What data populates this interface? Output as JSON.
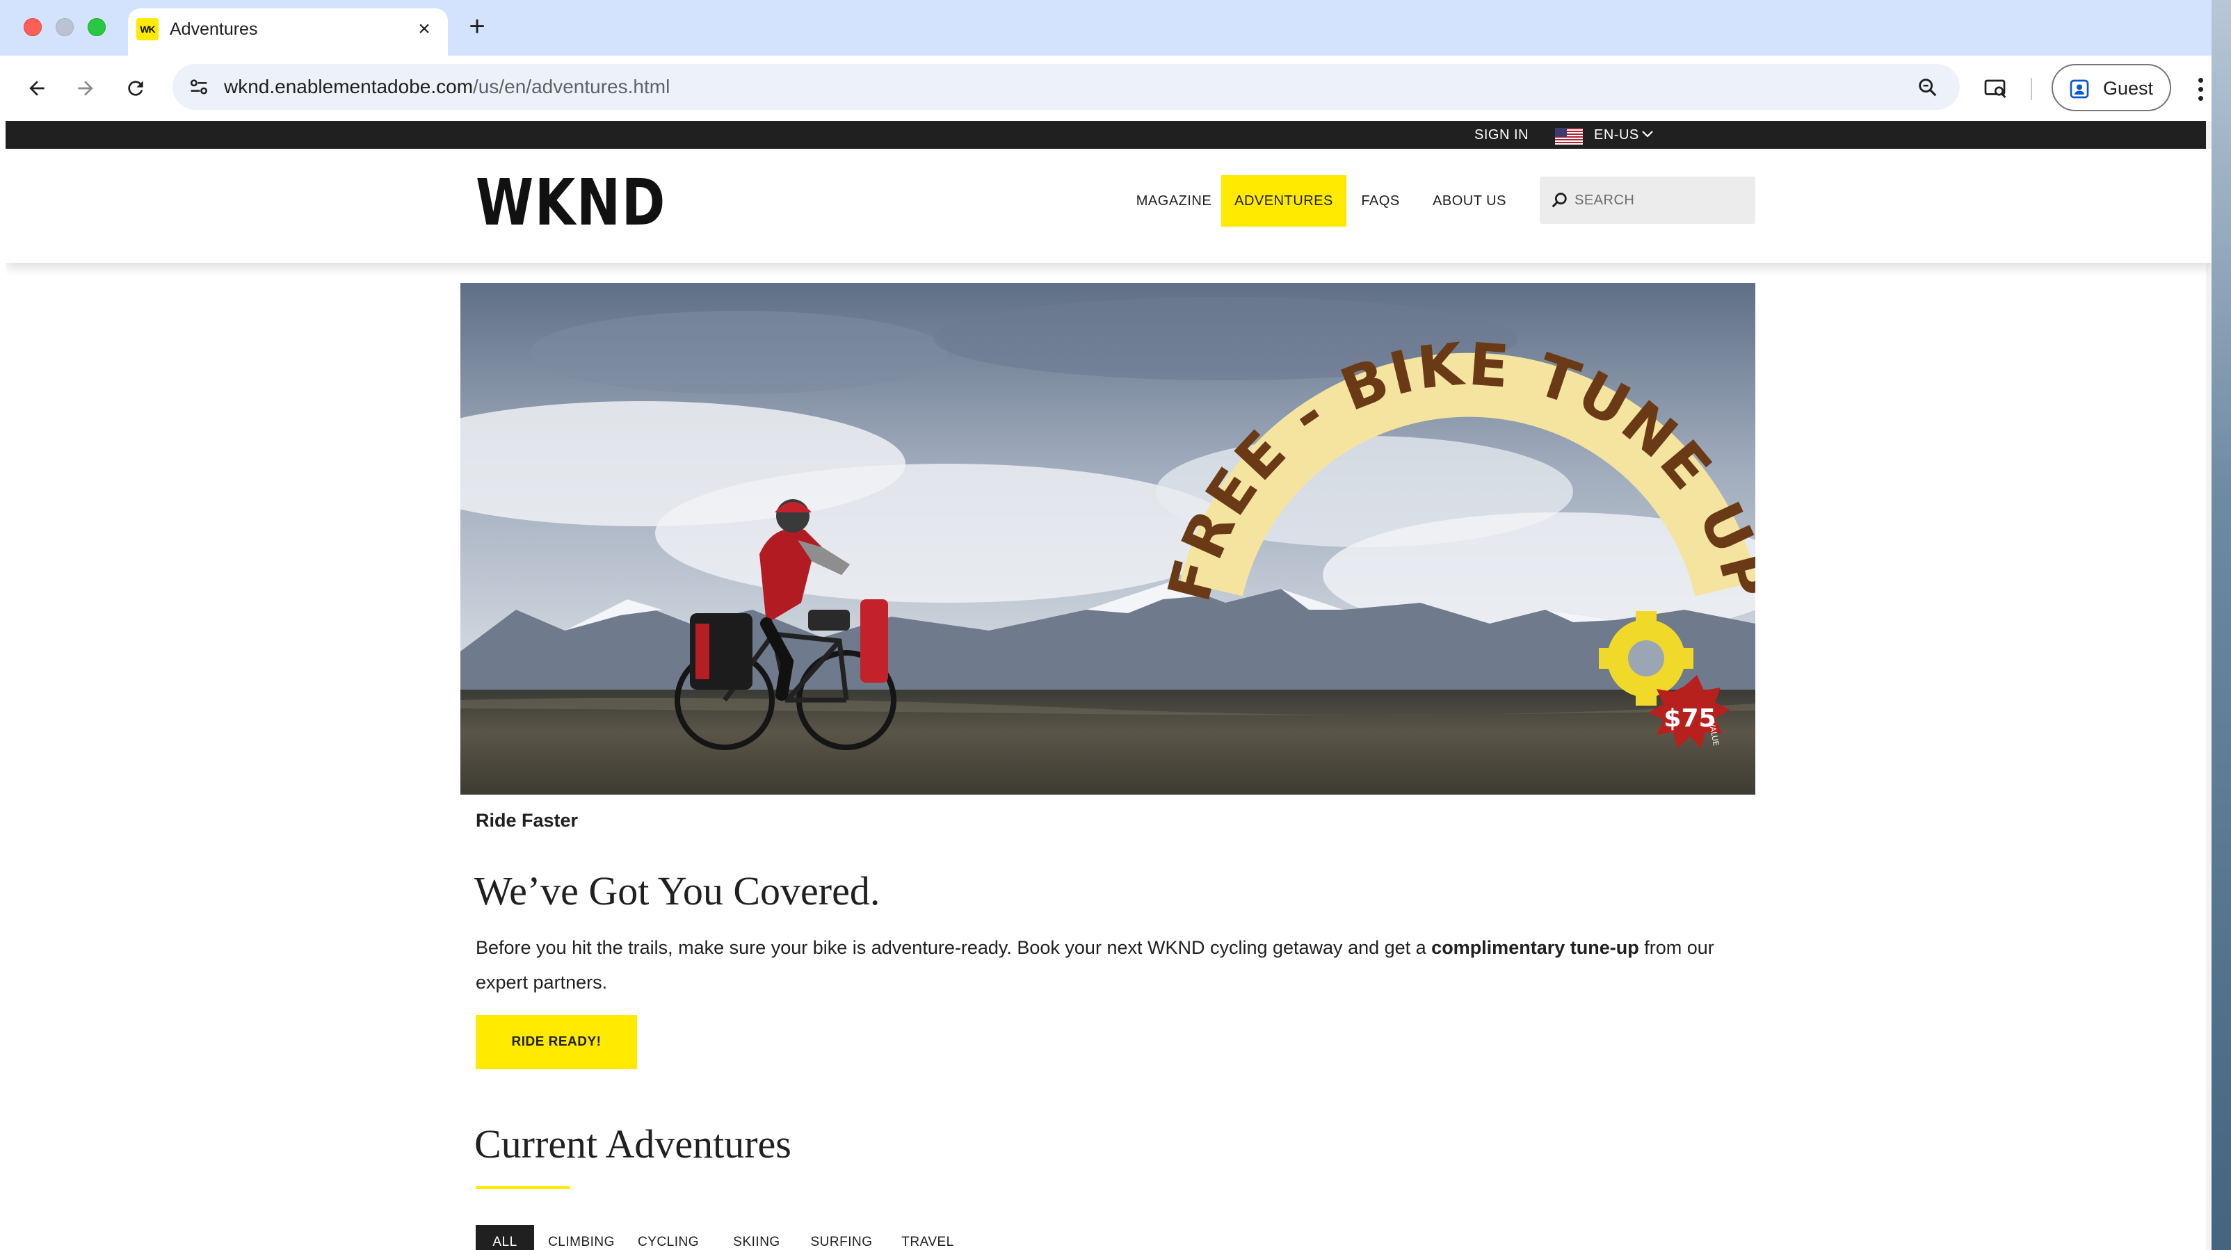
{
  "browser": {
    "tab_title": "Adventures",
    "tab_favicon_text": "WK",
    "new_tab_symbol": "+",
    "close_symbol": "×",
    "url_host": "wknd.enablementadobe.com",
    "url_path": "/us/en/adventures.html",
    "profile_label": "Guest"
  },
  "utility_bar": {
    "sign_in": "SIGN IN",
    "language": "EN-US"
  },
  "header": {
    "logo": "WKND",
    "nav": [
      {
        "label": "MAGAZINE",
        "active": false
      },
      {
        "label": "ADVENTURES",
        "active": true
      },
      {
        "label": "FAQS",
        "active": false
      },
      {
        "label": "ABOUT US",
        "active": false
      }
    ],
    "search_placeholder": "SEARCH"
  },
  "hero": {
    "arch_text": "FREE - BIKE TUNE UP",
    "badge_price": "$75",
    "badge_sub": "VALUE"
  },
  "promo": {
    "caption": "Ride Faster",
    "headline": "We’ve Got You Covered.",
    "body_before": "Before you hit the trails, make sure your bike is adventure-ready. Book your next WKND cycling getaway and get a ",
    "body_bold": "complimentary tune-up",
    "body_after": " from our expert partners.",
    "cta": "RIDE READY!"
  },
  "adventures": {
    "title": "Current Adventures",
    "filters": [
      {
        "label": "ALL",
        "active": true
      },
      {
        "label": "CLIMBING",
        "active": false
      },
      {
        "label": "CYCLING",
        "active": false
      },
      {
        "label": "SKIING",
        "active": false
      },
      {
        "label": "SURFING",
        "active": false
      },
      {
        "label": "TRAVEL",
        "active": false
      }
    ]
  },
  "colors": {
    "brand_yellow": "#ffea00",
    "dark": "#202020",
    "tab_strip": "#d3e3fd"
  },
  "icons": {
    "back": "arrow-left-icon",
    "forward": "arrow-right-icon",
    "reload": "reload-icon",
    "site_info": "tune-icon",
    "zoom": "magnifier-icon",
    "cast": "cast-search-icon",
    "profile": "person-icon",
    "menu": "kebab-icon",
    "search": "search-icon"
  }
}
